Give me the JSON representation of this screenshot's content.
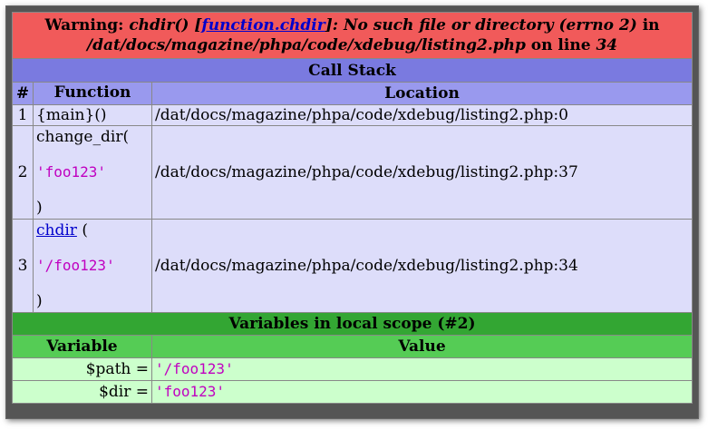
{
  "warning": {
    "label": "Warning:",
    "func": "chdir() [",
    "link": "function.chdir",
    "msg": "]: No such file or directory (errno 2)",
    "in": "in",
    "path": "/dat/docs/magazine/phpa/code/xdebug/listing2.php",
    "on_line": "on line",
    "line": "34"
  },
  "call_stack": {
    "title": "Call Stack",
    "headers": [
      "#",
      "Function",
      "Location"
    ],
    "rows": [
      {
        "num": "1",
        "func": "{main}()",
        "location": "/dat/docs/magazine/phpa/code/xdebug/listing2.php:0"
      },
      {
        "num": "2",
        "func": "change_dir(",
        "arg": "'foo123'",
        "close": ")",
        "location": "/dat/docs/magazine/phpa/code/xdebug/listing2.php:37"
      },
      {
        "num": "3",
        "func": "chdir",
        "open": " (",
        "arg": "'/foo123'",
        "close": ")",
        "location": "/dat/docs/magazine/phpa/code/xdebug/listing2.php:34"
      }
    ]
  },
  "vars": {
    "title": "Variables in local scope (#2)",
    "headers": [
      "Variable",
      "Value"
    ],
    "rows": [
      {
        "name": "$path =",
        "value": "'/foo123'"
      },
      {
        "name": "$dir =",
        "value": "'foo123'"
      }
    ]
  }
}
